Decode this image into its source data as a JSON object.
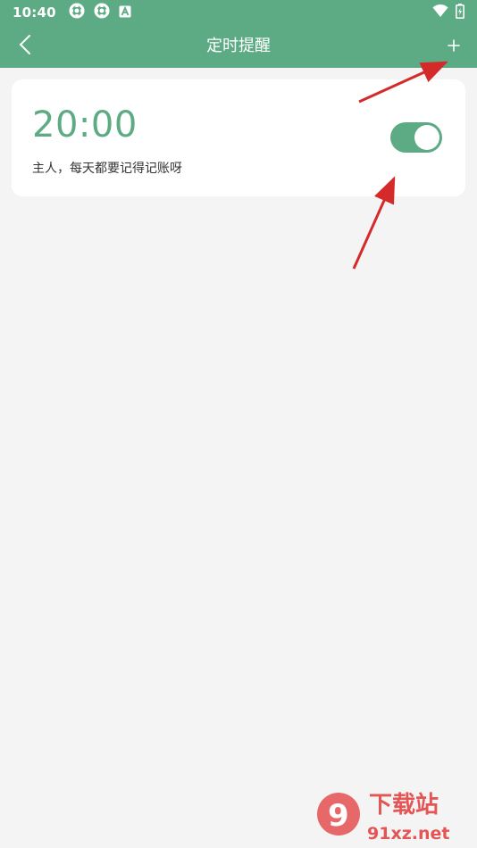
{
  "status_bar": {
    "time": "10:40",
    "left_icons": [
      "settings-gear-icon",
      "settings-gear-icon",
      "notification-a-icon"
    ],
    "right_icons": [
      "wifi-icon",
      "battery-charging-icon"
    ]
  },
  "app_bar": {
    "back_icon": "chevron-left-icon",
    "title": "定时提醒",
    "add_icon": "plus-icon",
    "background_color": "#5dab84"
  },
  "reminders": [
    {
      "time": "20:00",
      "message": "主人，每天都要记得记账呀",
      "enabled": true
    }
  ],
  "annotations": {
    "arrow_color": "#d42a2a",
    "arrows": [
      "pointing-to-add-button",
      "pointing-to-toggle"
    ]
  },
  "watermark": {
    "logo_number": "9",
    "text_cn": "下载站",
    "text_domain": "91xz.net"
  }
}
